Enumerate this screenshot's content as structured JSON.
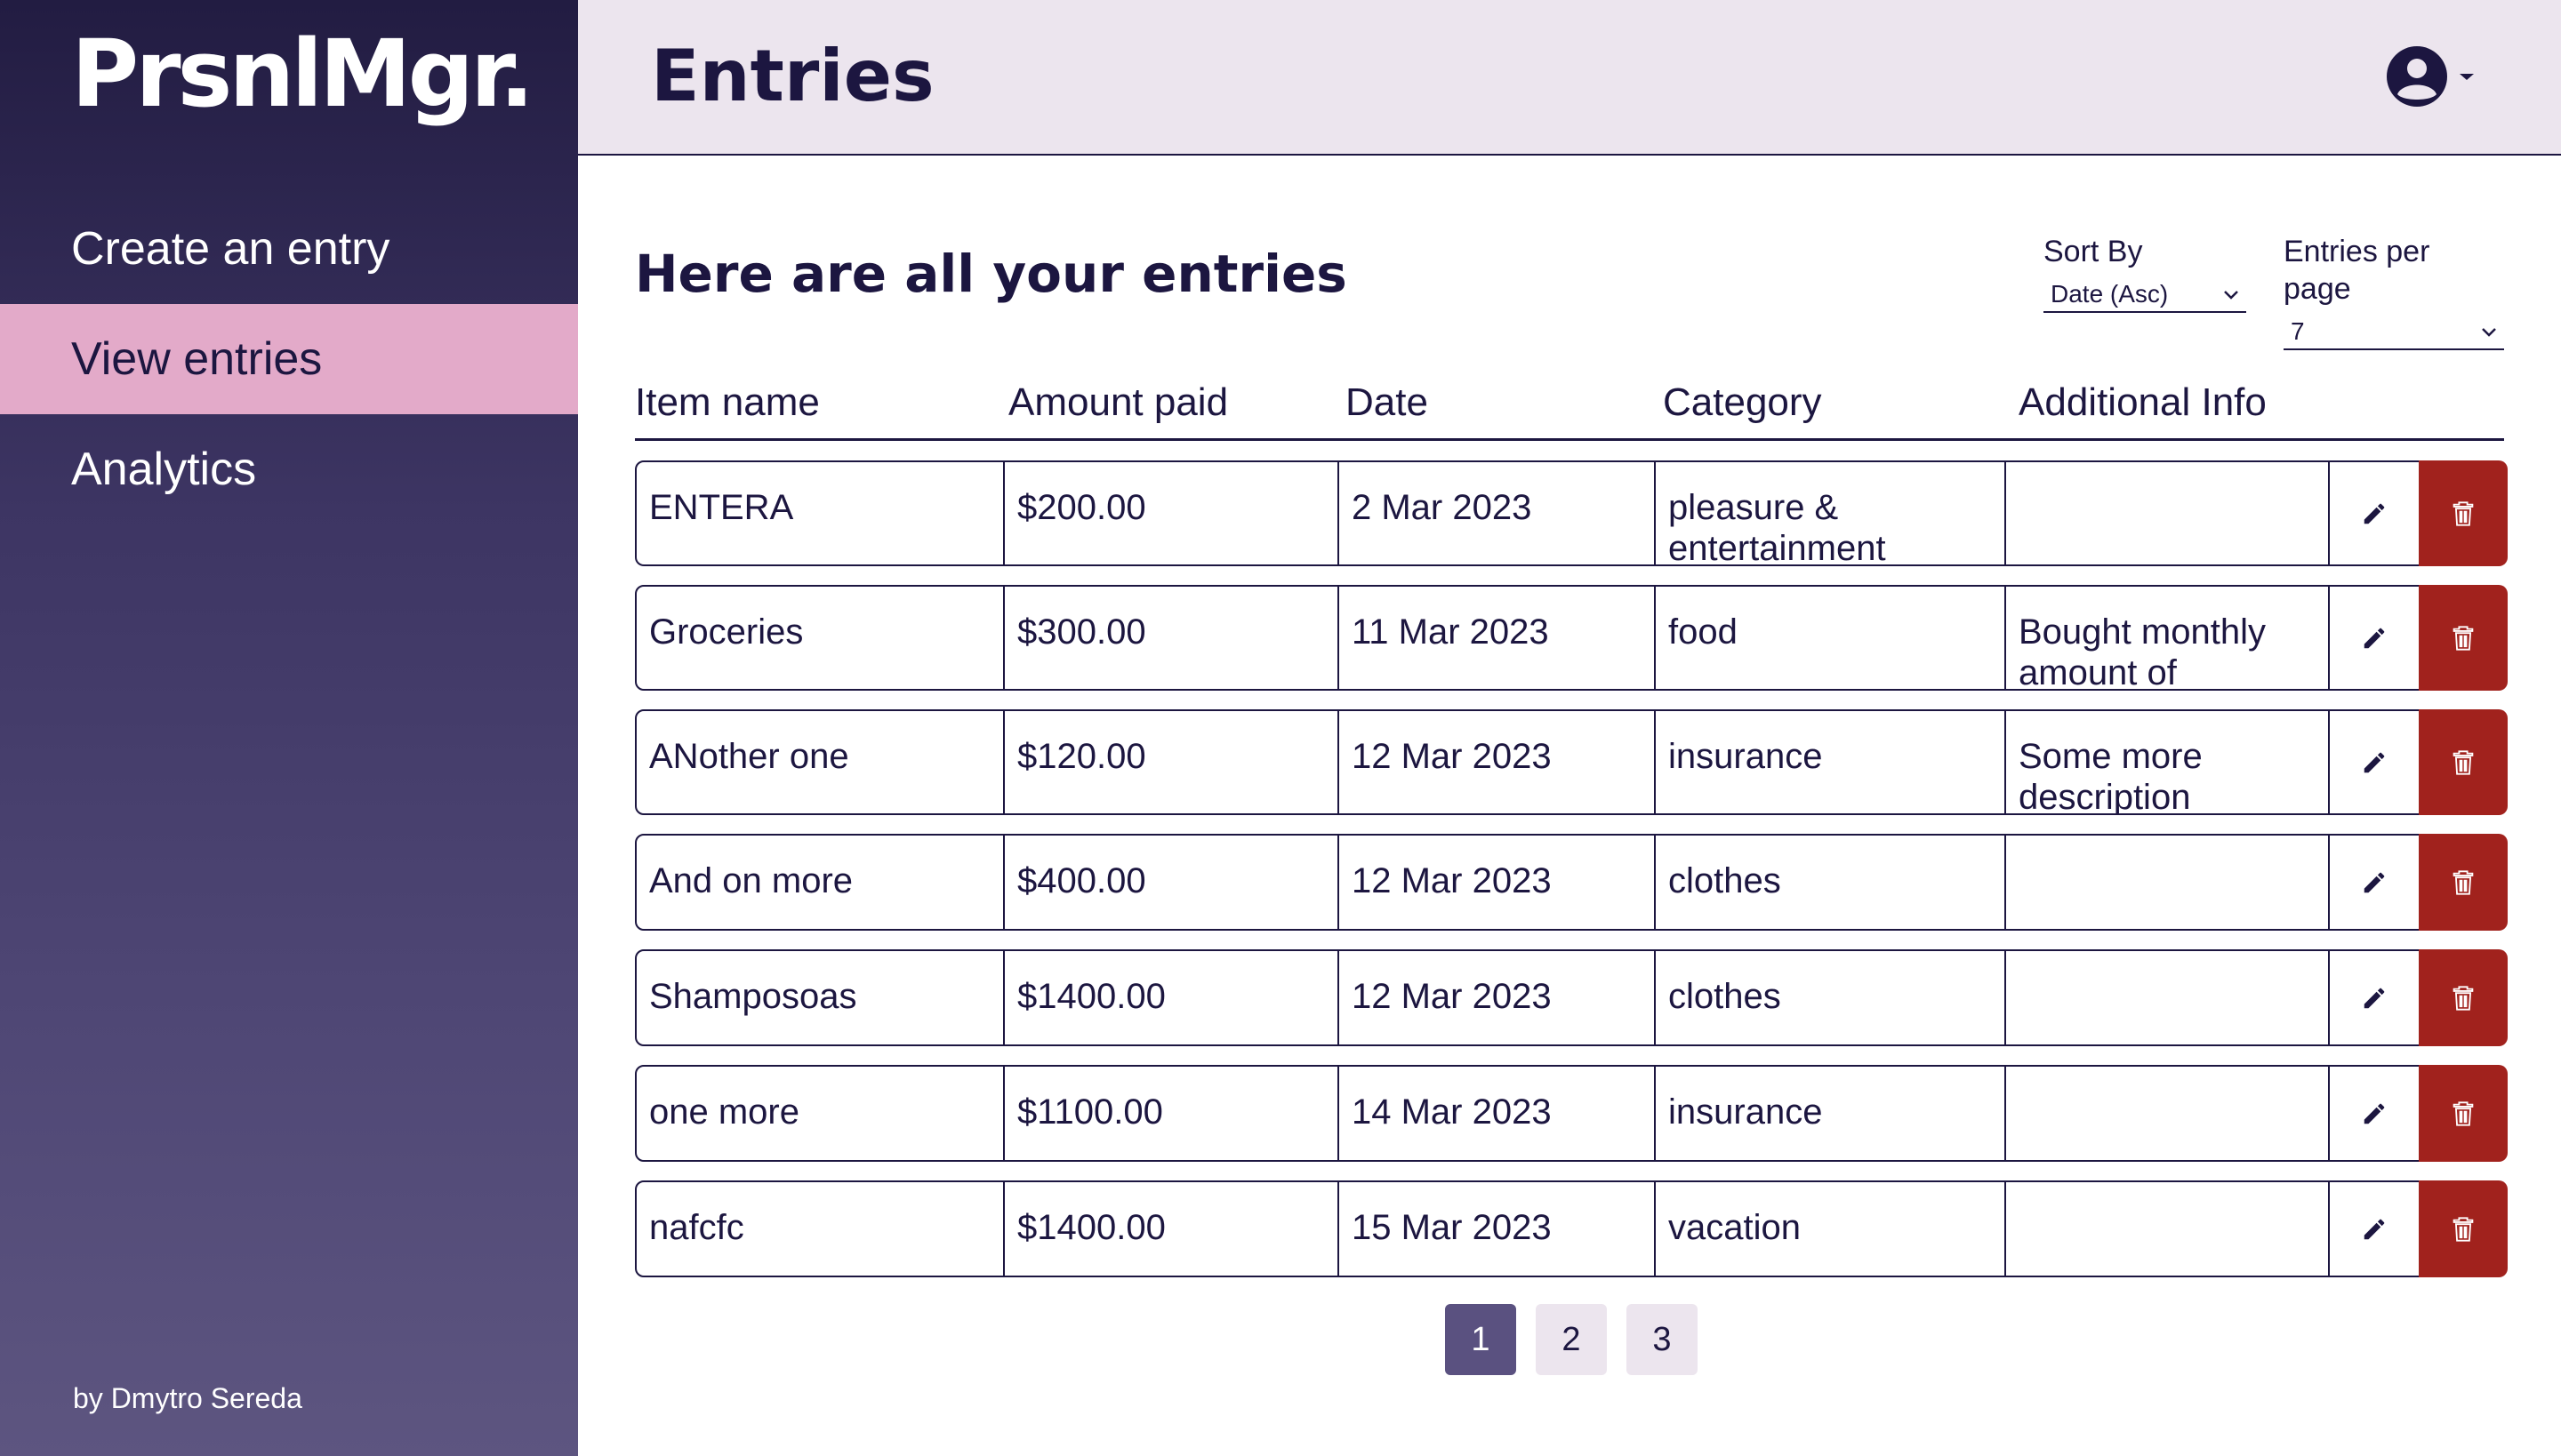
{
  "app": {
    "logo": "PrsnlMgr.",
    "author": "by Dmytro Sereda"
  },
  "sidebar": {
    "items": [
      {
        "label": "Create an entry",
        "active": false
      },
      {
        "label": "View entries",
        "active": true
      },
      {
        "label": "Analytics",
        "active": false
      }
    ]
  },
  "header": {
    "title": "Entries",
    "account_icon": "user-circle-icon"
  },
  "main": {
    "heading": "Here are all your entries",
    "sort": {
      "label": "Sort By",
      "value": "Date (Asc)"
    },
    "per_page": {
      "label": "Entries per page",
      "value": "7"
    },
    "columns": [
      "Item name",
      "Amount paid",
      "Date",
      "Category",
      "Additional Info"
    ],
    "rows": [
      {
        "name": "ENTERA",
        "amount": "$200.00",
        "date": "2 Mar 2023",
        "category": "pleasure & entertainment",
        "info": ""
      },
      {
        "name": "Groceries",
        "amount": "$300.00",
        "date": "11 Mar 2023",
        "category": "food",
        "info": "Bought monthly amount of"
      },
      {
        "name": "ANother one",
        "amount": "$120.00",
        "date": "12 Mar 2023",
        "category": "insurance",
        "info": "Some more description"
      },
      {
        "name": "And on more",
        "amount": "$400.00",
        "date": "12 Mar 2023",
        "category": "clothes",
        "info": ""
      },
      {
        "name": "Shamposoas",
        "amount": "$1400.00",
        "date": "12 Mar 2023",
        "category": "clothes",
        "info": ""
      },
      {
        "name": "one more",
        "amount": "$1100.00",
        "date": "14 Mar 2023",
        "category": "insurance",
        "info": ""
      },
      {
        "name": "nafcfc",
        "amount": "$1400.00",
        "date": "15 Mar 2023",
        "category": "vacation",
        "info": ""
      }
    ],
    "row_icons": {
      "edit": "pencil-icon",
      "delete": "trash-icon"
    }
  },
  "pagination": {
    "pages": [
      "1",
      "2",
      "3"
    ],
    "current": "1"
  },
  "colors": {
    "navy": "#1c1640",
    "sidebar_top": "#221c42",
    "sidebar_bottom": "#5d5580",
    "active_nav": "#e3aac9",
    "header_bg": "#ece5ee",
    "delete_red": "#a1221d",
    "page_active": "#5a5180"
  }
}
